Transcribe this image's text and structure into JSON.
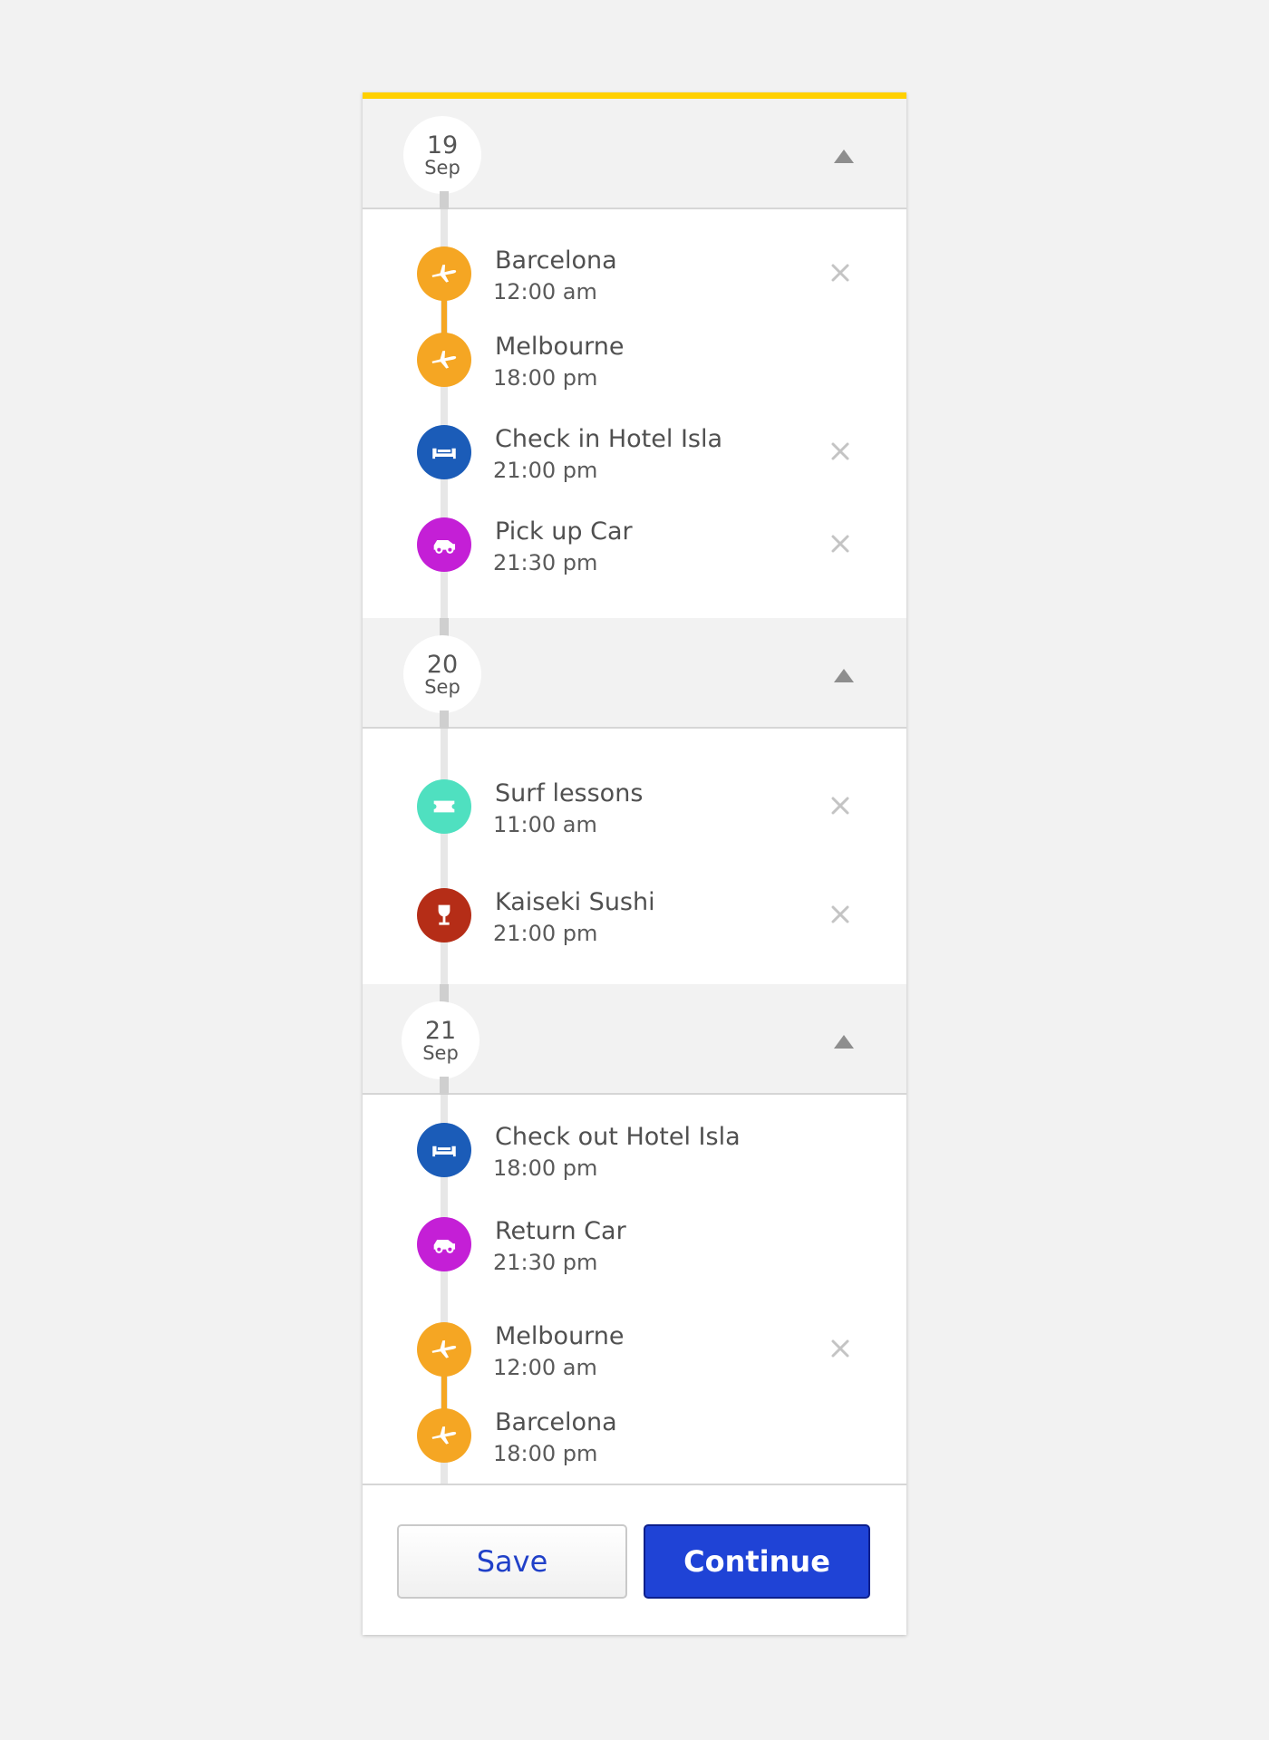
{
  "colors": {
    "accent": "#ffd000",
    "flight": "#f5a623",
    "hotel": "#1b5cb8",
    "car": "#c41fd6",
    "activity": "#4fe0c0",
    "dining": "#b52d17",
    "primary_button": "#1f43d6"
  },
  "days": [
    {
      "day": "19",
      "month": "Sep",
      "events": [
        {
          "title": "Barcelona",
          "time": "12:00 am",
          "icon": "plane-icon",
          "type": "flight",
          "removable": true
        },
        {
          "title": "Melbourne",
          "time": "18:00 pm",
          "icon": "plane-icon",
          "type": "flight",
          "removable": false
        },
        {
          "title": "Check in Hotel Isla",
          "time": "21:00 pm",
          "icon": "bed-icon",
          "type": "hotel",
          "removable": true
        },
        {
          "title": "Pick up Car",
          "time": "21:30 pm",
          "icon": "car-icon",
          "type": "car",
          "removable": true
        }
      ]
    },
    {
      "day": "20",
      "month": "Sep",
      "events": [
        {
          "title": "Surf lessons",
          "time": "11:00 am",
          "icon": "ticket-icon",
          "type": "activity",
          "removable": true
        },
        {
          "title": "Kaiseki Sushi",
          "time": "21:00 pm",
          "icon": "wine-glass-icon",
          "type": "dining",
          "removable": true
        }
      ]
    },
    {
      "day": "21",
      "month": "Sep",
      "events": [
        {
          "title": "Check out Hotel Isla",
          "time": "18:00 pm",
          "icon": "bed-icon",
          "type": "hotel",
          "removable": false
        },
        {
          "title": "Return Car",
          "time": "21:30 pm",
          "icon": "car-icon",
          "type": "car",
          "removable": false
        },
        {
          "title": "Melbourne",
          "time": "12:00 am",
          "icon": "plane-icon",
          "type": "flight",
          "removable": true
        },
        {
          "title": "Barcelona",
          "time": "18:00 pm",
          "icon": "plane-icon",
          "type": "flight",
          "removable": false
        }
      ]
    }
  ],
  "actions": {
    "save_label": "Save",
    "continue_label": "Continue"
  }
}
